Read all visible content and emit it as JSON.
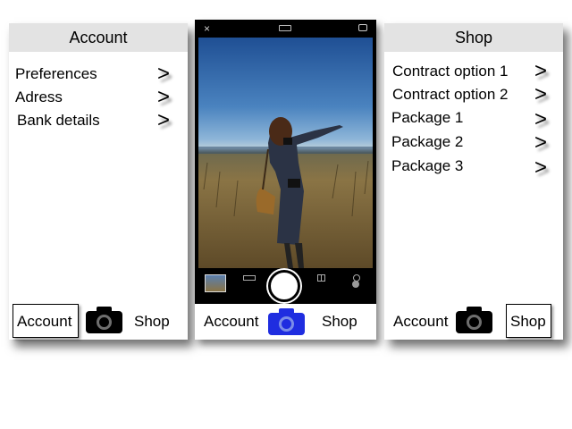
{
  "account_screen": {
    "title": "Account",
    "items": [
      {
        "label": "Preferences"
      },
      {
        "label": "Adress"
      },
      {
        "label": "Bank details"
      }
    ],
    "chevron": ">"
  },
  "shop_screen": {
    "title": "Shop",
    "items": [
      {
        "label": "Contract option 1"
      },
      {
        "label": "Contract option 2"
      },
      {
        "label": "Package 1"
      },
      {
        "label": "Package 2"
      },
      {
        "label": "Package 3"
      }
    ],
    "chevron": ">"
  },
  "tabbar": {
    "account_label": "Account",
    "shop_label": "Shop",
    "camera_icon": "camera-icon"
  },
  "camera_screen": {
    "top_icons": [
      "close-icon",
      "flash-mode-icon",
      "camera-flip-icon"
    ],
    "bottom_icons": [
      "flash-icon",
      "format-icon",
      "exposure-icon",
      "grid-icon",
      "timer-icon"
    ],
    "close_glyph": "×"
  },
  "colors": {
    "header_bg": "#e3e3e3",
    "camera_active": "#1f2de0",
    "camera_inactive": "#000000"
  }
}
